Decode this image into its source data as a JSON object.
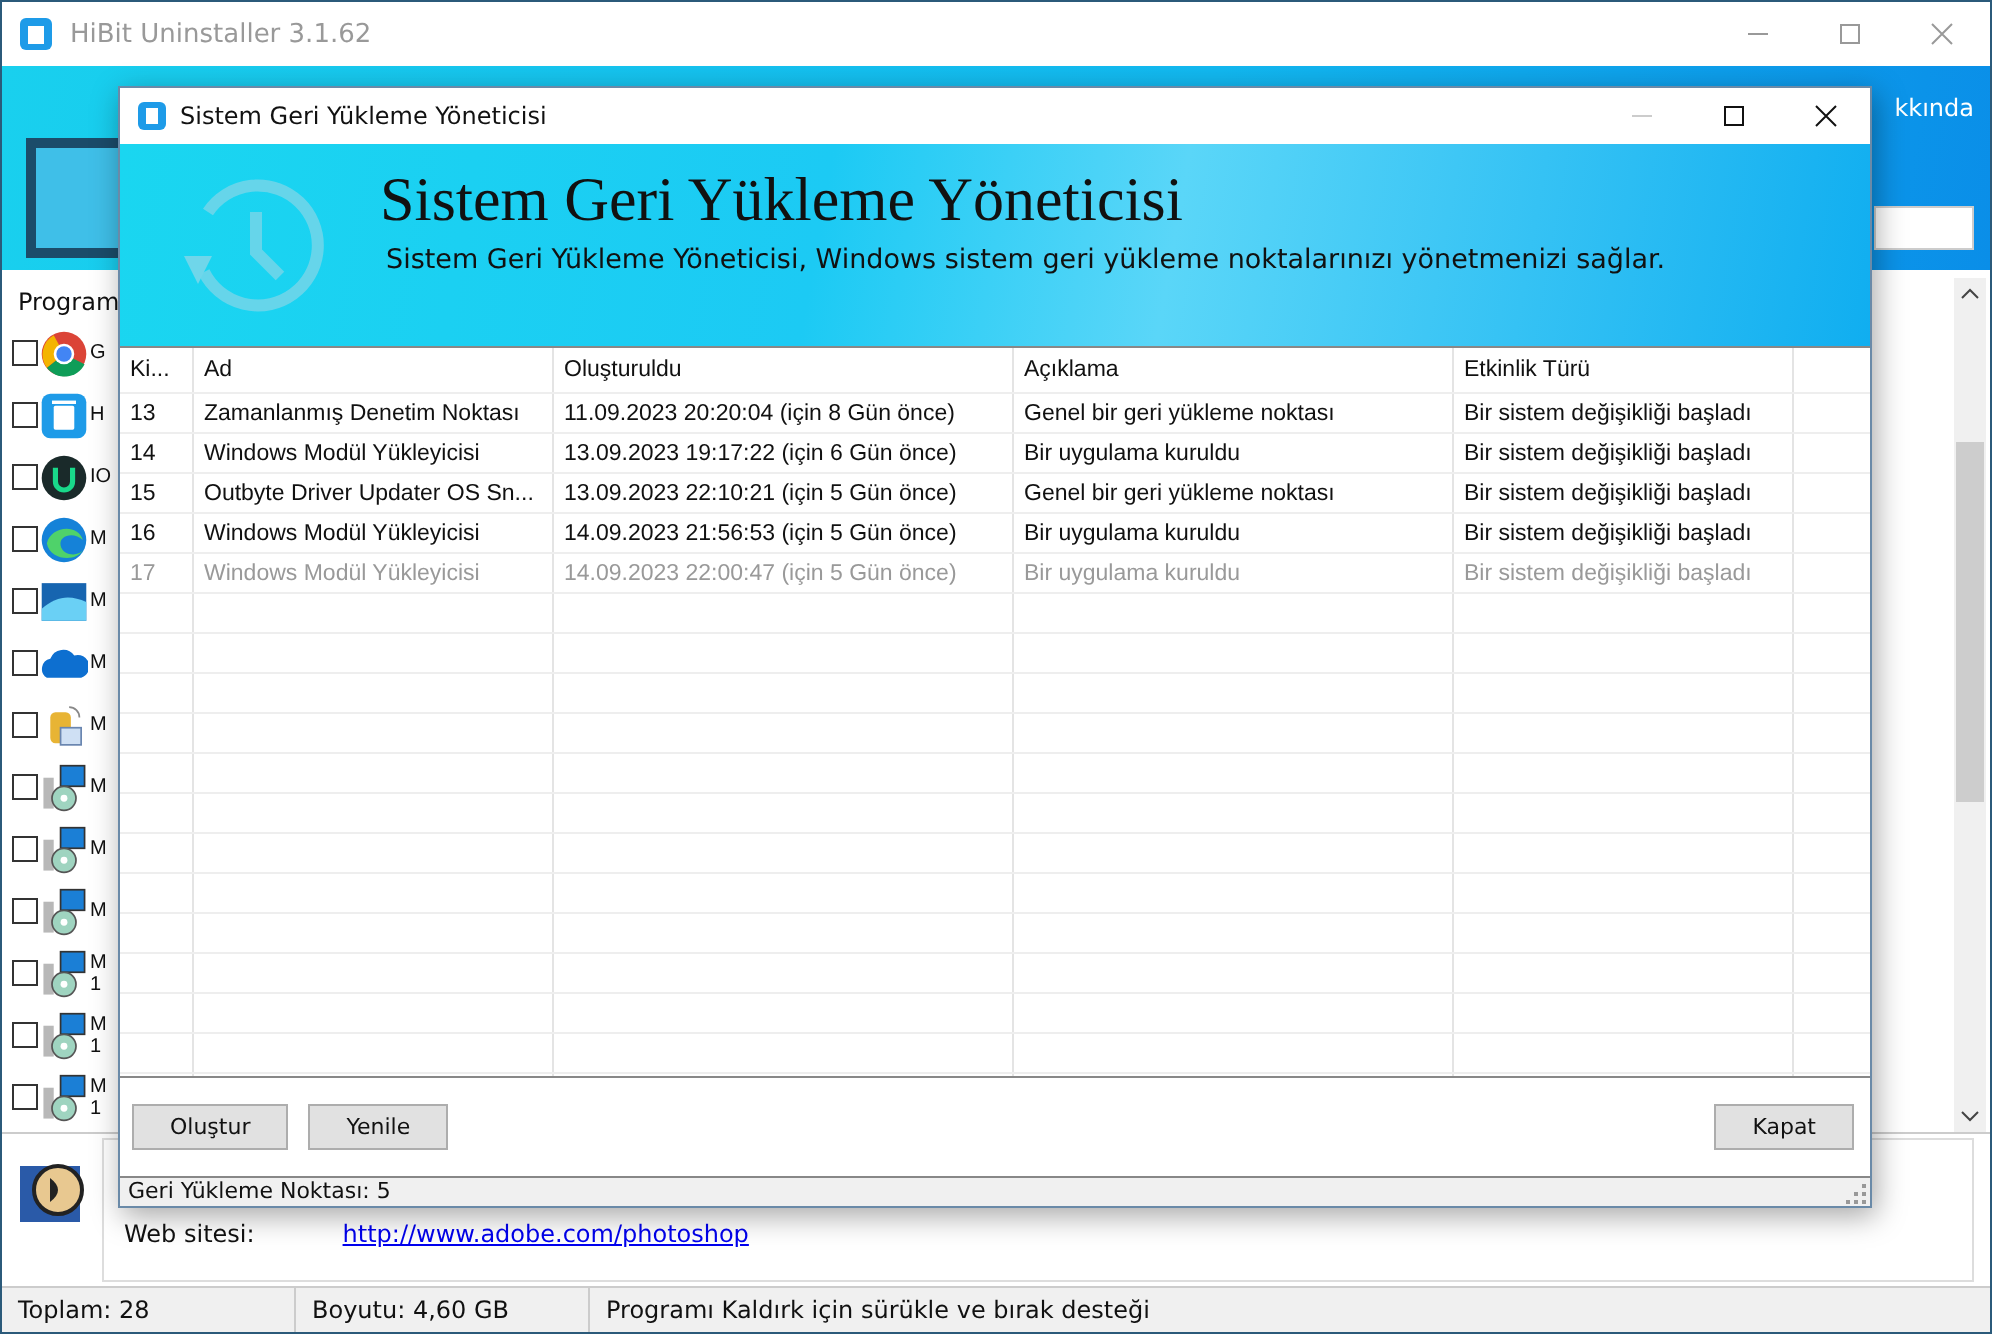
{
  "main_window": {
    "title": "HiBit Uninstaller 3.1.62",
    "menu_fragment": "kkında",
    "list_header": "Program",
    "programs": [
      {
        "name": "G",
        "kind": "ring",
        "checked": false
      },
      {
        "name": "H",
        "kind": "bin",
        "checked": false
      },
      {
        "name": "IO",
        "kind": "disc",
        "checked": false
      },
      {
        "name": "M",
        "kind": "wave",
        "checked": false
      },
      {
        "name": "M",
        "kind": "panel",
        "checked": false
      },
      {
        "name": "M",
        "kind": "cloud",
        "checked": false
      },
      {
        "name": "M",
        "kind": "drum",
        "checked": false
      },
      {
        "name": "M",
        "kind": "installer",
        "checked": false
      },
      {
        "name": "M",
        "kind": "installer",
        "checked": false
      },
      {
        "name": "M",
        "kind": "installer",
        "checked": false
      },
      {
        "name": "M",
        "line2": "1",
        "kind": "installer",
        "checked": false
      },
      {
        "name": "M",
        "line2": "1",
        "kind": "installer",
        "checked": false
      },
      {
        "name": "M",
        "line2": "1",
        "kind": "installer",
        "checked": false
      }
    ],
    "details": {
      "label": "Web sitesi:",
      "link": "http://www.adobe.com/photoshop"
    },
    "status_bar": [
      "Toplam: 28",
      "Boyutu: 4,60 GB",
      "Programı Kaldırk için sürükle ve bırak desteği"
    ]
  },
  "dialog": {
    "title": "Sistem Geri Yükleme Yöneticisi",
    "heading": "Sistem Geri Yükleme Yöneticisi",
    "subtitle": "Sistem Geri Yükleme Yöneticisi, Windows sistem geri yükleme noktalarınızı yönetmenizi sağlar.",
    "table": {
      "columns": [
        "Ki...",
        "Ad",
        "Oluşturuldu",
        "Açıklama",
        "Etkinlik Türü"
      ],
      "rows": [
        {
          "cells": [
            "13",
            "Zamanlanmış Denetim Noktası",
            "11.09.2023 20:20:04 (için 8 Gün önce)",
            "Genel bir geri yükleme noktası",
            "Bir sistem değişikliği başladı"
          ],
          "disabled": false
        },
        {
          "cells": [
            "14",
            "Windows Modül Yükleyicisi",
            "13.09.2023 19:17:22 (için 6 Gün önce)",
            "Bir uygulama kuruldu",
            "Bir sistem değişikliği başladı"
          ],
          "disabled": false
        },
        {
          "cells": [
            "15",
            "Outbyte Driver Updater OS Sn...",
            "13.09.2023 22:10:21 (için 5 Gün önce)",
            "Genel bir geri yükleme noktası",
            "Bir sistem değişikliği başladı"
          ],
          "disabled": false
        },
        {
          "cells": [
            "16",
            "Windows Modül Yükleyicisi",
            "14.09.2023 21:56:53 (için 5 Gün önce)",
            "Bir uygulama kuruldu",
            "Bir sistem değişikliği başladı"
          ],
          "disabled": false
        },
        {
          "cells": [
            "17",
            "Windows Modül Yükleyicisi",
            "14.09.2023 22:00:47 (için 5 Gün önce)",
            "Bir uygulama kuruldu",
            "Bir sistem değişikliği başladı"
          ],
          "disabled": true
        }
      ]
    },
    "left_buttons": [
      "Oluştur",
      "Yenile"
    ],
    "right_button": "Kapat",
    "status": "Geri Yükleme Noktası: 5"
  }
}
